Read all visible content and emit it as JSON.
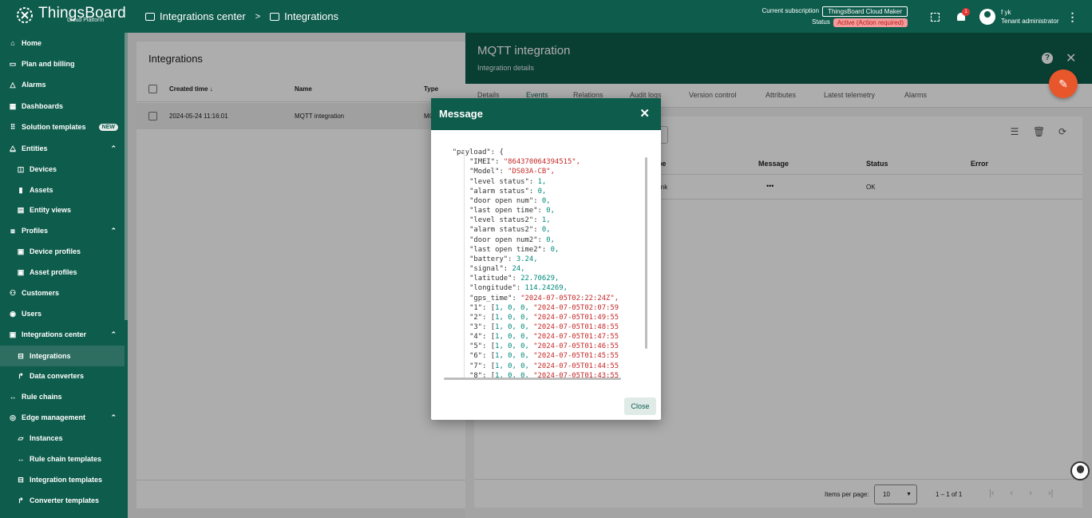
{
  "app": {
    "brand": "ThingsBoard",
    "brand_sub": "Cloud Platform"
  },
  "breadcrumb": [
    {
      "label": "Integrations center"
    },
    {
      "label": "Integrations"
    }
  ],
  "breadcrumb_sep": ">",
  "subscription": {
    "label": "Current subscription",
    "plan": "ThingsBoard Cloud Maker",
    "status_label": "Status",
    "status_value": "Active (Action required)"
  },
  "notifications": {
    "count": "1"
  },
  "user": {
    "name": "f yk",
    "role": "Tenant administrator"
  },
  "sidebar": {
    "items": [
      {
        "label": "Home",
        "icon": "home-icon"
      },
      {
        "label": "Plan and billing",
        "icon": "billing-icon"
      },
      {
        "label": "Alarms",
        "icon": "alarm-icon"
      },
      {
        "label": "Dashboards",
        "icon": "dashboard-icon"
      },
      {
        "label": "Solution templates",
        "icon": "grid-icon",
        "badge": "NEW"
      },
      {
        "label": "Entities",
        "icon": "entities-icon"
      },
      {
        "label": "Devices",
        "icon": "device-icon"
      },
      {
        "label": "Assets",
        "icon": "asset-icon"
      },
      {
        "label": "Entity views",
        "icon": "view-icon"
      },
      {
        "label": "Profiles",
        "icon": "profiles-icon"
      },
      {
        "label": "Device profiles",
        "icon": "device-profile-icon"
      },
      {
        "label": "Asset profiles",
        "icon": "asset-profile-icon"
      },
      {
        "label": "Customers",
        "icon": "customers-icon"
      },
      {
        "label": "Users",
        "icon": "users-icon"
      },
      {
        "label": "Integrations center",
        "icon": "integrations-center-icon"
      },
      {
        "label": "Integrations",
        "icon": "integration-icon"
      },
      {
        "label": "Data converters",
        "icon": "converter-icon"
      },
      {
        "label": "Rule chains",
        "icon": "rule-chain-icon"
      },
      {
        "label": "Edge management",
        "icon": "edge-icon"
      },
      {
        "label": "Instances",
        "icon": "instances-icon"
      },
      {
        "label": "Rule chain templates",
        "icon": "rule-template-icon"
      },
      {
        "label": "Integration templates",
        "icon": "integration-template-icon"
      },
      {
        "label": "Converter templates",
        "icon": "converter-template-icon"
      }
    ]
  },
  "integrations": {
    "title": "Integrations",
    "columns": [
      "Created time",
      "Name",
      "Type"
    ],
    "rows": [
      {
        "created": "2024-05-24 11:16:01",
        "name": "MQTT integration",
        "type": "MQTT"
      }
    ]
  },
  "panel": {
    "title": "MQTT integration",
    "subtitle": "Integration details",
    "tabs": [
      "Details",
      "Events",
      "Relations",
      "Audit logs",
      "Version control",
      "Attributes",
      "Latest telemetry",
      "Alarms"
    ],
    "events": {
      "columns": [
        "Type",
        "Message",
        "Status",
        "Error"
      ],
      "row": {
        "type": "Uplink",
        "message": "•••",
        "status": "OK"
      },
      "items_per_page_label": "Items per page:",
      "items_per_page": "10",
      "range": "1 – 1 of 1"
    }
  },
  "dialog": {
    "title": "Message",
    "close_label": "Close",
    "payload": [
      {
        "key": "\"payload\": {",
        "val": "",
        "t": "k",
        "indent": 0
      },
      {
        "key": "\"IMEI\": ",
        "val": "\"864370064394515\",",
        "t": "s",
        "indent": 1
      },
      {
        "key": "\"Model\": ",
        "val": "\"DS03A-CB\",",
        "t": "s",
        "indent": 1
      },
      {
        "key": "\"level status\": ",
        "val": "1,",
        "t": "n",
        "indent": 1
      },
      {
        "key": "\"alarm status\": ",
        "val": "0,",
        "t": "n",
        "indent": 1
      },
      {
        "key": "\"door open num\": ",
        "val": "0,",
        "t": "n",
        "indent": 1
      },
      {
        "key": "\"last open time\": ",
        "val": "0,",
        "t": "n",
        "indent": 1
      },
      {
        "key": "\"level status2\": ",
        "val": "1,",
        "t": "n",
        "indent": 1
      },
      {
        "key": "\"alarm status2\": ",
        "val": "0,",
        "t": "n",
        "indent": 1
      },
      {
        "key": "\"door open num2\": ",
        "val": "0,",
        "t": "n",
        "indent": 1
      },
      {
        "key": "\"last open time2\": ",
        "val": "0,",
        "t": "n",
        "indent": 1
      },
      {
        "key": "\"battery\": ",
        "val": "3.24,",
        "t": "n",
        "indent": 1
      },
      {
        "key": "\"signal\": ",
        "val": "24,",
        "t": "n",
        "indent": 1
      },
      {
        "key": "\"latitude\": ",
        "val": "22.70629,",
        "t": "n",
        "indent": 1
      },
      {
        "key": "\"longitude\": ",
        "val": "114.24269,",
        "t": "n",
        "indent": 1
      },
      {
        "key": "\"gps_time\": ",
        "val": "\"2024-07-05T02:22:24Z\",",
        "t": "s",
        "indent": 1
      },
      {
        "key": "\"1\": [",
        "val": "1, 0, 0, \"2024-07-05T02:07:59",
        "t": "a",
        "indent": 1
      },
      {
        "key": "\"2\": [",
        "val": "1, 0, 0, \"2024-07-05T01:49:55",
        "t": "a",
        "indent": 1
      },
      {
        "key": "\"3\": [",
        "val": "1, 0, 0, \"2024-07-05T01:48:55",
        "t": "a",
        "indent": 1
      },
      {
        "key": "\"4\": [",
        "val": "1, 0, 0, \"2024-07-05T01:47:55",
        "t": "a",
        "indent": 1
      },
      {
        "key": "\"5\": [",
        "val": "1, 0, 0, \"2024-07-05T01:46:55",
        "t": "a",
        "indent": 1
      },
      {
        "key": "\"6\": [",
        "val": "1, 0, 0, \"2024-07-05T01:45:55",
        "t": "a",
        "indent": 1
      },
      {
        "key": "\"7\": [",
        "val": "1, 0, 0, \"2024-07-05T01:44:55",
        "t": "a",
        "indent": 1
      },
      {
        "key": "\"8\": [",
        "val": "1, 0, 0, \"2024-07-05T01:43:55",
        "t": "a",
        "indent": 1
      }
    ]
  },
  "colors": {
    "primary": "#0e5c4c",
    "accent": "#e8572c",
    "string": "#c62828",
    "number": "#00897b"
  }
}
